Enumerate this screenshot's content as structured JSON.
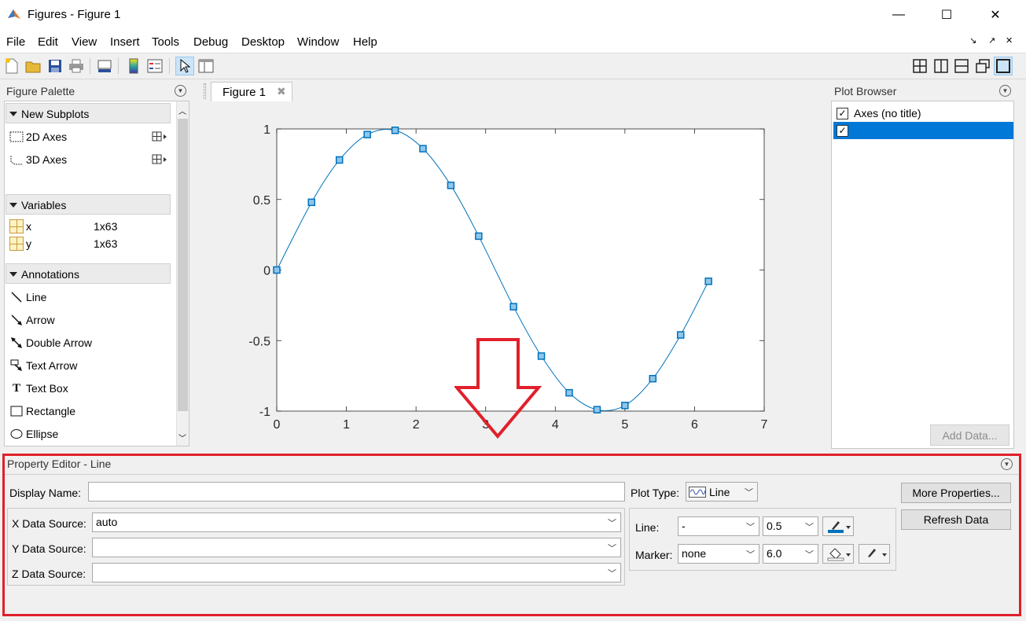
{
  "window": {
    "title": "Figures - Figure 1",
    "minimize": "—",
    "maximize": "☐",
    "close": "✕"
  },
  "menu": [
    "File",
    "Edit",
    "View",
    "Insert",
    "Tools",
    "Debug",
    "Desktop",
    "Window",
    "Help"
  ],
  "palette": {
    "header": "Figure Palette",
    "sections": {
      "subplots": "New Subplots",
      "variables": "Variables",
      "annotations": "Annotations"
    },
    "subplots": [
      {
        "label": "2D Axes"
      },
      {
        "label": "3D Axes"
      }
    ],
    "variables": [
      {
        "name": "x",
        "size": "1x63"
      },
      {
        "name": "y",
        "size": "1x63"
      }
    ],
    "annotations": [
      "Line",
      "Arrow",
      "Double Arrow",
      "Text Arrow",
      "Text Box",
      "Rectangle",
      "Ellipse"
    ]
  },
  "figure_tab": {
    "label": "Figure 1"
  },
  "chart_data": {
    "type": "line",
    "marker": "square",
    "color": "#0072bd",
    "xlim": [
      0,
      7
    ],
    "ylim": [
      -1,
      1
    ],
    "xticks": [
      "0",
      "1",
      "2",
      "3",
      "4",
      "5",
      "6",
      "7"
    ],
    "yticks": [
      "1",
      "0.5",
      "0",
      "-0.5",
      "-1"
    ],
    "x": [
      0,
      0.5,
      0.9,
      1.3,
      1.7,
      2.1,
      2.5,
      2.9,
      3.4,
      3.8,
      4.2,
      4.6,
      5.0,
      5.4,
      5.8,
      6.2
    ],
    "y": [
      0,
      0.48,
      0.78,
      0.96,
      0.99,
      0.86,
      0.6,
      0.24,
      -0.26,
      -0.61,
      -0.87,
      -0.99,
      -0.96,
      -0.77,
      -0.46,
      -0.08
    ],
    "grid": false
  },
  "plot_browser": {
    "header": "Plot Browser",
    "items": [
      {
        "label": "Axes (no title)",
        "checked": true
      },
      {
        "label": "",
        "checked": true
      }
    ],
    "add_data": "Add Data..."
  },
  "property_editor": {
    "header": "Property Editor - Line",
    "display_name_label": "Display Name:",
    "display_name_value": "",
    "x_source_label": "X Data Source:",
    "x_source_value": "auto",
    "y_source_label": "Y Data Source:",
    "y_source_value": "",
    "z_source_label": "Z Data Source:",
    "z_source_value": "",
    "plot_type_label": "Plot Type:",
    "plot_type_value": "Line",
    "line_label": "Line:",
    "line_style_value": "-",
    "line_width_value": "0.5",
    "marker_label": "Marker:",
    "marker_value": "none",
    "marker_size_value": "6.0",
    "more_properties": "More Properties...",
    "refresh_data": "Refresh Data"
  }
}
